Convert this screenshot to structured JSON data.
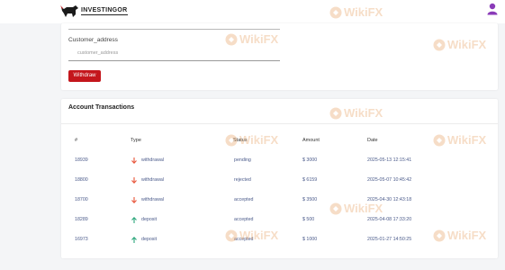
{
  "header": {
    "brand": "INVESTINGOR",
    "avatar_icon": "user-avatar-icon"
  },
  "form": {
    "address_label": "Customer_address",
    "address_placeholder": "customer_address",
    "withdraw_label": "Withdraw"
  },
  "transactions": {
    "title": "Account Transactions",
    "columns": [
      "#",
      "Type",
      "Status",
      "Amount",
      "Date"
    ],
    "rows": [
      {
        "id": "18939",
        "type": "withdrawal",
        "direction": "down",
        "status": "pending",
        "amount": "$ 3000",
        "date": "2025-05-13 12:15:41"
      },
      {
        "id": "18800",
        "type": "withdrawal",
        "direction": "down",
        "status": "rejected",
        "amount": "$ 6159",
        "date": "2025-05-07 10:45:42"
      },
      {
        "id": "18700",
        "type": "withdrawal",
        "direction": "down",
        "status": "accepted",
        "amount": "$ 3500",
        "date": "2025-04-30 12:43:18"
      },
      {
        "id": "18289",
        "type": "deposit",
        "direction": "up",
        "status": "accepted",
        "amount": "$ 500",
        "date": "2025-04-08 17:33:20"
      },
      {
        "id": "16973",
        "type": "deposit",
        "direction": "up",
        "status": "accepted",
        "amount": "$ 1000",
        "date": "2025-01-27 14:50:25"
      }
    ]
  },
  "watermark": {
    "text": "WikiFX",
    "color": "#e8a060"
  },
  "colors": {
    "accent": "#c4161c",
    "withdrawal_arrow": "#e8553a",
    "deposit_arrow": "#2aa57a",
    "link_text": "#4a5a8a"
  }
}
